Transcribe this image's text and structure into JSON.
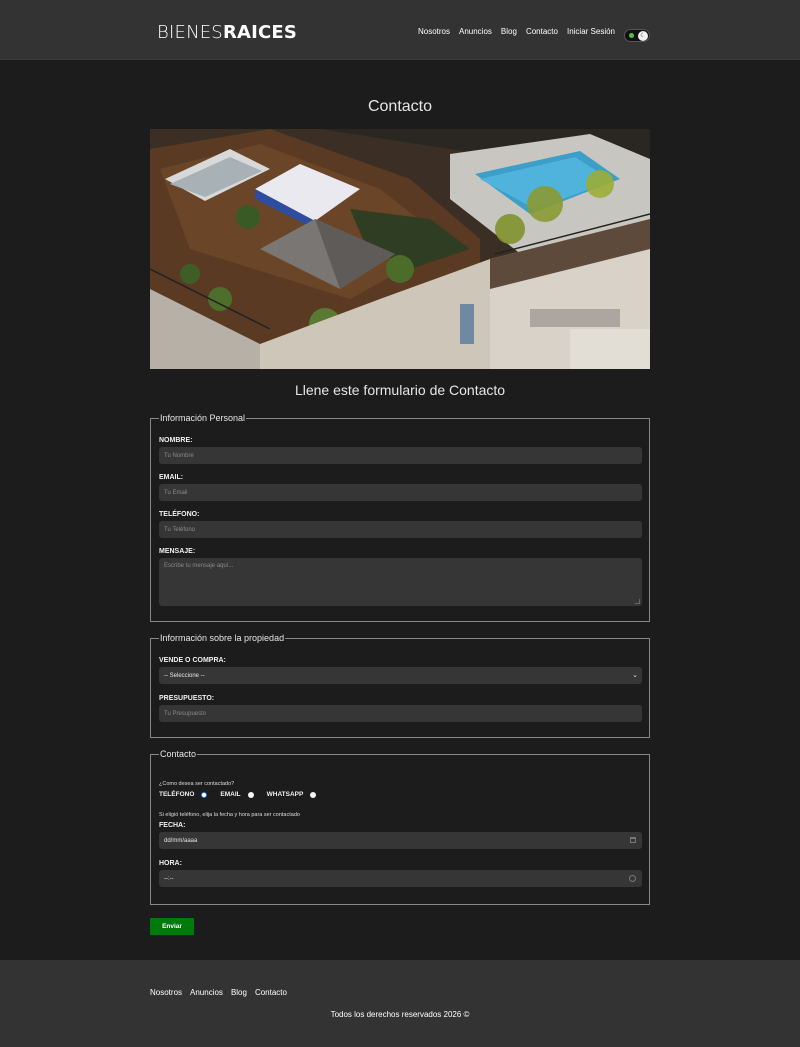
{
  "header": {
    "logo_light": "BIENES",
    "logo_bold": "RAICES",
    "nav": [
      "Nosotros",
      "Anuncios",
      "Blog",
      "Contacto",
      "Iniciar Sesión"
    ]
  },
  "main": {
    "title": "Contacto",
    "subtitle": "Llene este formulario de Contacto",
    "personal": {
      "legend": "Información Personal",
      "name_label": "NOMBRE:",
      "name_placeholder": "Tu Nombre",
      "email_label": "EMAIL:",
      "email_placeholder": "Tu Email",
      "phone_label": "TELÉFONO:",
      "phone_placeholder": "Tu Teléfono",
      "message_label": "MENSAJE:",
      "message_placeholder": "Escribe tu mensaje aquí..."
    },
    "property": {
      "legend": "Información sobre la propiedad",
      "type_label": "VENDE O COMPRA:",
      "type_selected": "-- Seleccione --",
      "budget_label": "PRESUPUESTO:",
      "budget_placeholder": "Tu Presupuesto"
    },
    "contact": {
      "legend": "Contacto",
      "question": "¿Como desea ser contactado?",
      "options": [
        "TELÉFONO",
        "EMAIL",
        "WHATSAPP"
      ],
      "selected_option": "TELÉFONO",
      "phone_note": "Si eligió teléfono, elija la fecha y hora para ser contactado",
      "date_label": "FECHA:",
      "date_value": "dd/mm/aaaa",
      "time_label": "HORA:",
      "time_value": "--:--"
    },
    "submit_label": "Enviar"
  },
  "footer": {
    "nav": [
      "Nosotros",
      "Anuncios",
      "Blog",
      "Contacto"
    ],
    "copyright": "Todos los derechos reservados 2026 ©"
  },
  "colors": {
    "background": "#1c1c1c",
    "header": "#333333",
    "input": "#363636",
    "accent_green": "#007a0b",
    "radio_blue": "#2e7bdc"
  },
  "icons": [
    "moon-sun-toggle-icon",
    "chevron-down-icon",
    "calendar-icon",
    "clock-icon"
  ]
}
